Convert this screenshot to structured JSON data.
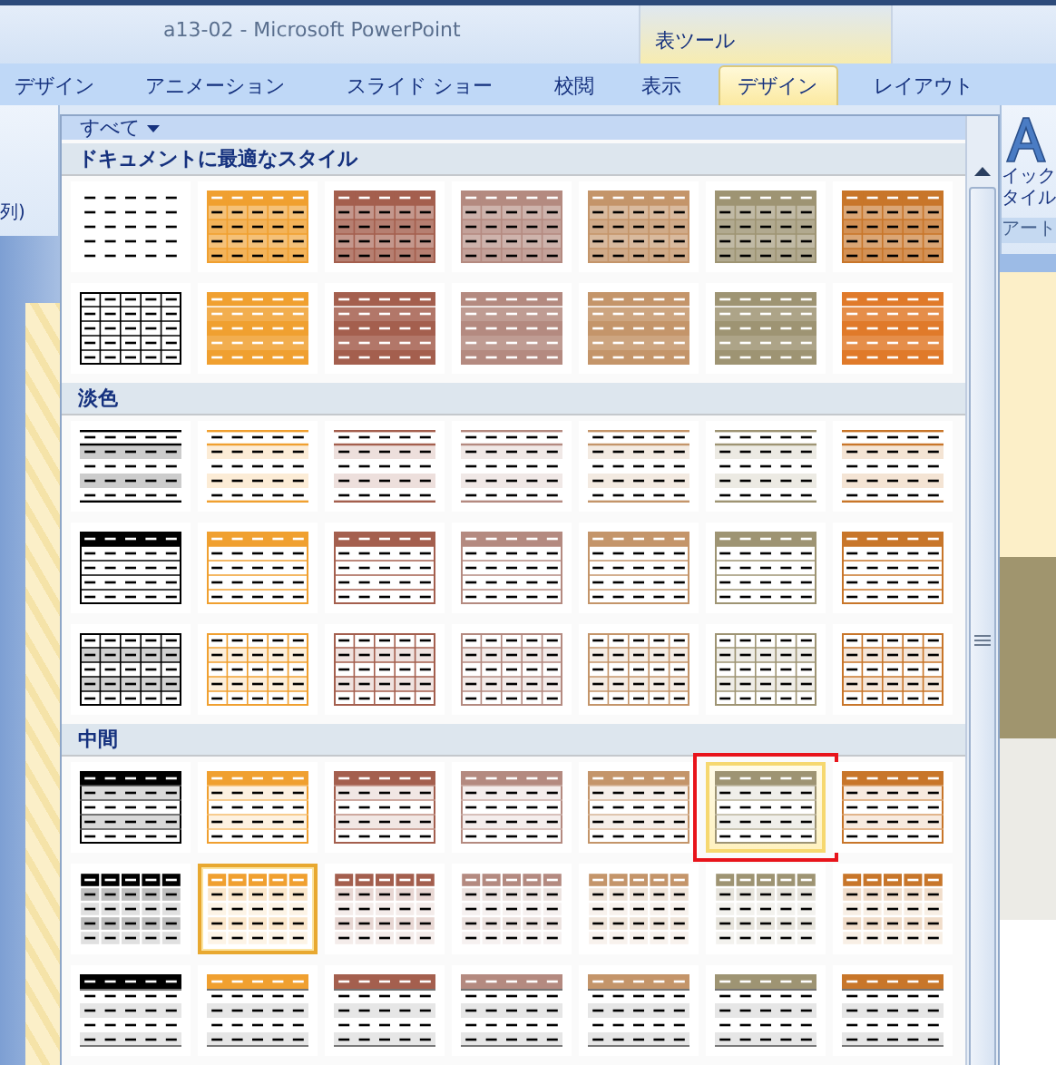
{
  "window": {
    "title": "a13-02 - Microsoft PowerPoint",
    "context_group": "表ツール"
  },
  "tabs": [
    {
      "label": "デザイン",
      "selected": false
    },
    {
      "label": "アニメーション",
      "selected": false
    },
    {
      "label": "スライド ショー",
      "selected": false
    },
    {
      "label": "校閲",
      "selected": false
    },
    {
      "label": "表示",
      "selected": false
    },
    {
      "label": "デザイン",
      "selected": true
    },
    {
      "label": "レイアウト",
      "selected": false
    }
  ],
  "ribbon_left": {
    "text": "列)"
  },
  "ribbon_right": {
    "lines": [
      "イック",
      "タイル"
    ],
    "group_label": "アート"
  },
  "gallery": {
    "filter": "すべて",
    "sections": [
      {
        "title": "ドキュメントに最適なスタイル",
        "items": [
          {
            "kind": "plain",
            "color": "#000000",
            "selected": false,
            "highlighted": false
          },
          {
            "kind": "medium-grid",
            "color": "#f0a030",
            "selected": false,
            "highlighted": false
          },
          {
            "kind": "medium-grid",
            "color": "#a45f4e",
            "selected": false,
            "highlighted": false
          },
          {
            "kind": "medium-grid",
            "color": "#b48a80",
            "selected": false,
            "highlighted": false
          },
          {
            "kind": "medium-grid",
            "color": "#c4956a",
            "selected": false,
            "highlighted": false
          },
          {
            "kind": "medium-grid",
            "color": "#9e9473",
            "selected": false,
            "highlighted": false
          },
          {
            "kind": "medium-grid",
            "color": "#c8762a",
            "selected": false,
            "highlighted": false
          },
          {
            "kind": "grid",
            "color": "#000000",
            "selected": false,
            "highlighted": false
          },
          {
            "kind": "banded-fill",
            "color": "#f0a030",
            "selected": false,
            "highlighted": false
          },
          {
            "kind": "banded-fill",
            "color": "#a45f4e",
            "selected": false,
            "highlighted": false
          },
          {
            "kind": "banded-fill",
            "color": "#b48a80",
            "selected": false,
            "highlighted": false
          },
          {
            "kind": "banded-fill",
            "color": "#c4956a",
            "selected": false,
            "highlighted": false
          },
          {
            "kind": "banded-fill",
            "color": "#9e9473",
            "selected": false,
            "highlighted": false
          },
          {
            "kind": "banded-fill",
            "color": "#e07a2a",
            "selected": false,
            "highlighted": false
          }
        ]
      },
      {
        "title": "淡色",
        "items": [
          {
            "kind": "light-banded",
            "color": "#000000",
            "selected": false,
            "highlighted": false
          },
          {
            "kind": "light-banded",
            "color": "#f0a030",
            "selected": false,
            "highlighted": false
          },
          {
            "kind": "light-banded",
            "color": "#a45f4e",
            "selected": false,
            "highlighted": false
          },
          {
            "kind": "light-banded",
            "color": "#b48a80",
            "selected": false,
            "highlighted": false
          },
          {
            "kind": "light-banded",
            "color": "#c4956a",
            "selected": false,
            "highlighted": false
          },
          {
            "kind": "light-banded",
            "color": "#9e9473",
            "selected": false,
            "highlighted": false
          },
          {
            "kind": "light-banded",
            "color": "#c8762a",
            "selected": false,
            "highlighted": false
          },
          {
            "kind": "light-header",
            "color": "#000000",
            "selected": false,
            "highlighted": false
          },
          {
            "kind": "light-header",
            "color": "#f0a030",
            "selected": false,
            "highlighted": false
          },
          {
            "kind": "light-header",
            "color": "#a45f4e",
            "selected": false,
            "highlighted": false
          },
          {
            "kind": "light-header",
            "color": "#b48a80",
            "selected": false,
            "highlighted": false
          },
          {
            "kind": "light-header",
            "color": "#c4956a",
            "selected": false,
            "highlighted": false
          },
          {
            "kind": "light-header",
            "color": "#9e9473",
            "selected": false,
            "highlighted": false
          },
          {
            "kind": "light-header",
            "color": "#c8762a",
            "selected": false,
            "highlighted": false
          },
          {
            "kind": "light-grid",
            "color": "#000000",
            "selected": false,
            "highlighted": false
          },
          {
            "kind": "light-grid",
            "color": "#f0a030",
            "selected": false,
            "highlighted": false
          },
          {
            "kind": "light-grid",
            "color": "#a45f4e",
            "selected": false,
            "highlighted": false
          },
          {
            "kind": "light-grid",
            "color": "#b48a80",
            "selected": false,
            "highlighted": false
          },
          {
            "kind": "light-grid",
            "color": "#c4956a",
            "selected": false,
            "highlighted": false
          },
          {
            "kind": "light-grid",
            "color": "#9e9473",
            "selected": false,
            "highlighted": false
          },
          {
            "kind": "light-grid",
            "color": "#c8762a",
            "selected": false,
            "highlighted": false
          }
        ]
      },
      {
        "title": "中間",
        "items": [
          {
            "kind": "medium-header",
            "color": "#000000",
            "selected": false,
            "highlighted": false
          },
          {
            "kind": "medium-header",
            "color": "#f0a030",
            "selected": false,
            "highlighted": false
          },
          {
            "kind": "medium-header",
            "color": "#a45f4e",
            "selected": false,
            "highlighted": false
          },
          {
            "kind": "medium-header",
            "color": "#b48a80",
            "selected": false,
            "highlighted": false
          },
          {
            "kind": "medium-header",
            "color": "#c4956a",
            "selected": false,
            "highlighted": false
          },
          {
            "kind": "medium-header",
            "color": "#9e9473",
            "selected": false,
            "highlighted": true
          },
          {
            "kind": "medium-header",
            "color": "#c8762a",
            "selected": false,
            "highlighted": false
          },
          {
            "kind": "medium-cells",
            "color": "#000000",
            "selected": false,
            "highlighted": false
          },
          {
            "kind": "medium-cells",
            "color": "#f0a030",
            "selected": true,
            "highlighted": false
          },
          {
            "kind": "medium-cells",
            "color": "#a45f4e",
            "selected": false,
            "highlighted": false
          },
          {
            "kind": "medium-cells",
            "color": "#b48a80",
            "selected": false,
            "highlighted": false
          },
          {
            "kind": "medium-cells",
            "color": "#c4956a",
            "selected": false,
            "highlighted": false
          },
          {
            "kind": "medium-cells",
            "color": "#9e9473",
            "selected": false,
            "highlighted": false
          },
          {
            "kind": "medium-cells",
            "color": "#c8762a",
            "selected": false,
            "highlighted": false
          },
          {
            "kind": "medium-rows",
            "color": "#000000",
            "selected": false,
            "highlighted": false
          },
          {
            "kind": "medium-rows",
            "color": "#f0a030",
            "selected": false,
            "highlighted": false
          },
          {
            "kind": "medium-rows",
            "color": "#a45f4e",
            "selected": false,
            "highlighted": false
          },
          {
            "kind": "medium-rows",
            "color": "#b48a80",
            "selected": false,
            "highlighted": false
          },
          {
            "kind": "medium-rows",
            "color": "#c4956a",
            "selected": false,
            "highlighted": false
          },
          {
            "kind": "medium-rows",
            "color": "#9e9473",
            "selected": false,
            "highlighted": false
          },
          {
            "kind": "medium-rows",
            "color": "#c8762a",
            "selected": false,
            "highlighted": false
          }
        ]
      }
    ]
  }
}
